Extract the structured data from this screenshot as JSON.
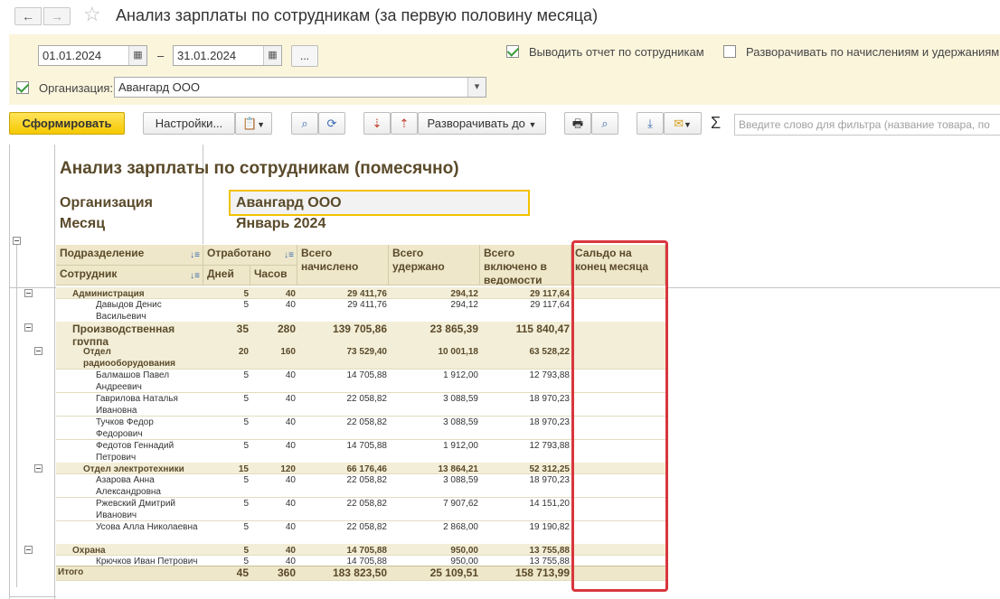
{
  "window": {
    "title": "Анализ зарплаты по сотрудникам (за первую половину месяца)",
    "back_icon": "←",
    "forward_icon": "→",
    "star_icon": "☆"
  },
  "params": {
    "date_from": "01.01.2024",
    "date_to": "31.01.2024",
    "dash": "–",
    "dots_label": "...",
    "org_label": "Организация:",
    "org_value": "Авангард ООО",
    "output_by_employee_label": "Выводить отчет по сотрудникам",
    "output_by_employee_checked": true,
    "expand_label": "Разворачивать по начислениям и удержаниям",
    "expand_checked": false,
    "org_checked": true
  },
  "toolbar": {
    "generate_label": "Сформировать",
    "settings_label": "Настройки...",
    "expand_to_label": "Разворачивать до",
    "sigma_label": "Σ",
    "filter_placeholder": "Введите слово для фильтра (название товара, по"
  },
  "report": {
    "title": "Анализ зарплаты по сотрудникам (помесячно)",
    "org_label": "Организация",
    "org_value": "Авангард ООО",
    "month_label": "Месяц",
    "month_value": "Январь 2024",
    "headers": {
      "subdivision": "Подразделение",
      "employee": "Сотрудник",
      "worked": "Отработано",
      "days": "Дней",
      "hours": "Часов",
      "accrued": "Всего начислено",
      "withheld": "Всего удержано",
      "included": "Всего включено в ведомости",
      "balance": "Сальдо на конец месяца"
    },
    "rows": [
      {
        "level": 1,
        "bold": true,
        "bg": true,
        "name": "Администрация",
        "days": "5",
        "hours": "40",
        "accrued": "29 411,76",
        "withheld": "294,12",
        "included": "29 117,64"
      },
      {
        "level": 3,
        "bold": false,
        "bg": false,
        "name": "Давыдов Денис Васильевич",
        "days": "5",
        "hours": "40",
        "accrued": "29 411,76",
        "withheld": "294,12",
        "included": "29 117,64"
      },
      {
        "level": 1,
        "bold": true,
        "bg": true,
        "big": true,
        "name": "Производственная группа",
        "days": "35",
        "hours": "280",
        "accrued": "139 705,86",
        "withheld": "23 865,39",
        "included": "115 840,47"
      },
      {
        "level": 2,
        "bold": true,
        "bg": true,
        "name": "Отдел радиооборудования",
        "days": "20",
        "hours": "160",
        "accrued": "73 529,40",
        "withheld": "10 001,18",
        "included": "63 528,22"
      },
      {
        "level": 3,
        "bold": false,
        "bg": false,
        "name": "Балмашов Павел Андреевич",
        "days": "5",
        "hours": "40",
        "accrued": "14 705,88",
        "withheld": "1 912,00",
        "included": "12 793,88"
      },
      {
        "level": 3,
        "bold": false,
        "bg": false,
        "name": "Гаврилова Наталья Ивановна",
        "days": "5",
        "hours": "40",
        "accrued": "22 058,82",
        "withheld": "3 088,59",
        "included": "18 970,23"
      },
      {
        "level": 3,
        "bold": false,
        "bg": false,
        "name": "Тучков Федор Федорович",
        "days": "5",
        "hours": "40",
        "accrued": "22 058,82",
        "withheld": "3 088,59",
        "included": "18 970,23"
      },
      {
        "level": 3,
        "bold": false,
        "bg": false,
        "name": "Федотов Геннадий Петрович",
        "days": "5",
        "hours": "40",
        "accrued": "14 705,88",
        "withheld": "1 912,00",
        "included": "12 793,88"
      },
      {
        "level": 2,
        "bold": true,
        "bg": true,
        "name": "Отдел электротехники",
        "days": "15",
        "hours": "120",
        "accrued": "66 176,46",
        "withheld": "13 864,21",
        "included": "52 312,25"
      },
      {
        "level": 3,
        "bold": false,
        "bg": false,
        "name": "Азарова Анна Александровна",
        "days": "5",
        "hours": "40",
        "accrued": "22 058,82",
        "withheld": "3 088,59",
        "included": "18 970,23"
      },
      {
        "level": 3,
        "bold": false,
        "bg": false,
        "name": "Ржевский Дмитрий Иванович",
        "days": "5",
        "hours": "40",
        "accrued": "22 058,82",
        "withheld": "7 907,62",
        "included": "14 151,20"
      },
      {
        "level": 3,
        "bold": false,
        "bg": false,
        "name": "Усова Алла Николаевна",
        "days": "5",
        "hours": "40",
        "accrued": "22 058,82",
        "withheld": "2 868,00",
        "included": "19 190,82"
      },
      {
        "level": 1,
        "bold": true,
        "bg": true,
        "name": "Охрана",
        "days": "5",
        "hours": "40",
        "accrued": "14 705,88",
        "withheld": "950,00",
        "included": "13 755,88"
      },
      {
        "level": 3,
        "bold": false,
        "bg": false,
        "name": "Крючков Иван Петрович",
        "days": "5",
        "hours": "40",
        "accrued": "14 705,88",
        "withheld": "950,00",
        "included": "13 755,88"
      },
      {
        "level": 0,
        "bold": true,
        "bg": true,
        "total": true,
        "name": "Итого",
        "days": "45",
        "hours": "360",
        "accrued": "183 823,50",
        "withheld": "25 109,51",
        "included": "158 713,99"
      }
    ]
  },
  "colors": {
    "accent_yellow": "#f5c900",
    "highlight_red": "#d9363e",
    "header_bg": "#eee7c9",
    "group_bg": "#f3eed8",
    "report_text": "#5a4a2a"
  }
}
